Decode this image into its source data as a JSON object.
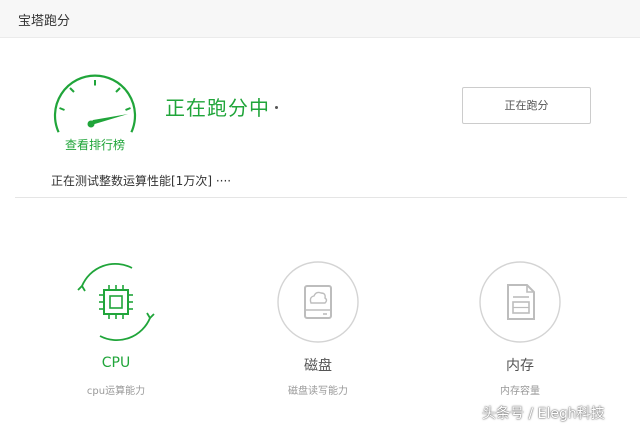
{
  "window": {
    "title": "宝塔跑分"
  },
  "gauge": {
    "label": "查看排行榜",
    "icon": "speedometer-icon",
    "color": "#20a53a"
  },
  "status": {
    "heading": "正在跑分中",
    "progress_text": "正在测试整数运算性能[1万次] ····"
  },
  "run_button": {
    "label": "正在跑分"
  },
  "items": [
    {
      "title": "CPU",
      "description": "cpu运算能力",
      "icon": "cpu-chip-icon",
      "state": "active",
      "color": "#20a53a"
    },
    {
      "title": "磁盘",
      "description": "磁盘读写能力",
      "icon": "disk-icon",
      "state": "idle",
      "color": "#999999"
    },
    {
      "title": "内存",
      "description": "内存容量",
      "icon": "memory-document-icon",
      "state": "idle",
      "color": "#999999"
    }
  ],
  "watermark": {
    "text": "头条号 / Elegh科技"
  }
}
